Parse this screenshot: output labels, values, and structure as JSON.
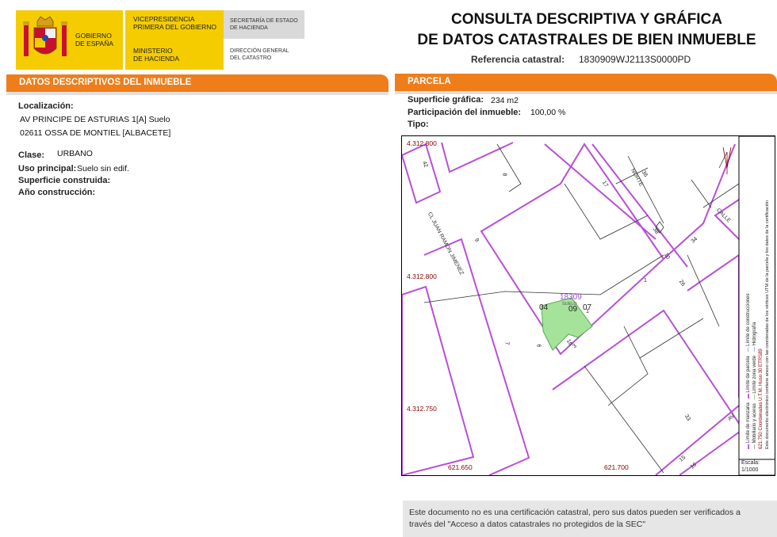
{
  "header": {
    "gov_line1": "GOBIERNO",
    "gov_line2": "DE ESPAÑA",
    "vice_line1": "VICEPRESIDENCIA",
    "vice_line2": "PRIMERA DEL GOBIERNO",
    "min_line1": "MINISTERIO",
    "min_line2": "DE HACIENDA",
    "sec_line1": "SECRETARÍA DE ESTADO",
    "sec_line2": "DE HACIENDA",
    "dir_line1": "DIRECCIÓN GENERAL",
    "dir_line2": "DEL CATASTRO",
    "title_line1": "CONSULTA DESCRIPTIVA Y GRÁFICA",
    "title_line2": "DE DATOS CATASTRALES DE BIEN INMUEBLE",
    "refcat_label": "Referencia catastral:",
    "refcat_value": "1830909WJ2113S0000PD"
  },
  "left": {
    "bar_title": "DATOS DESCRIPTIVOS DEL INMUEBLE",
    "localizacion_label": "Localización:",
    "address1": "AV PRINCIPE DE ASTURIAS 1[A] Suelo",
    "address2": "02611 OSSA DE MONTIEL [ALBACETE]",
    "clase_label": "Clase:",
    "clase_value": "URBANO",
    "uso_label": "Uso principal:",
    "uso_value": "Suelo sin edif.",
    "sup_label": "Superficie construida:",
    "anio_label": "Año construcción:"
  },
  "right": {
    "bar_title": "PARCELA",
    "supgraf_label": "Superficie gráfica:",
    "supgraf_value": "234 m2",
    "part_label": "Participación del inmueble:",
    "part_value": "100,00 %",
    "tipo_label": "Tipo:"
  },
  "map": {
    "coord_y1": "4.312.800",
    "coord_y2": "4.312.800",
    "coord_y3": "4.312.750",
    "coord_x1": "621.650",
    "coord_x2": "621.700",
    "parcel_id": "18309",
    "parcel_sub": "SUELO",
    "lbl_09": "09",
    "lbl_04": "04",
    "lbl_07": "07",
    "street1": "CL JUAN RAMON JIMENEZ",
    "street2": "NORTE",
    "street3": "CALLE",
    "street4": "AV",
    "n8": "8",
    "n7": "7",
    "n6": "6",
    "n16": "16",
    "n3": "3",
    "n1": "1",
    "n15": "15",
    "n17": "17",
    "n36": "36",
    "n34": "34",
    "n10": "10",
    "n38": "38",
    "n9": "9",
    "n1b": "1",
    "n26": "26",
    "n33": "33",
    "n42": "42",
    "n16b": "16",
    "legend_l1": "Límite de manzana",
    "legend_l2": "Límite de parcela",
    "legend_l3": "Límite de construcciones",
    "legend_l4": "Mobiliario y aceras",
    "legend_l5": "Límite zona verde",
    "legend_l6": "Hidrografía",
    "legend_coords": "621.750 Coordenadas U.T.M. Huso 30 ETRS89",
    "legend_doc": "Este documento electrónico contiene anexo con las coordenadas de los vértices UTM de la parcela y los datos de la certificación",
    "scale_label": "Escala:",
    "scale_value": "1/1000"
  },
  "notice": {
    "line1": "Este documento no es una certificación catastral, pero sus datos pueden ser verificados a",
    "line2": "través del \"Acceso a datos catastrales no protegidos de la SEC\""
  },
  "colors": {
    "orange": "#ef7d1a",
    "yellow": "#f4cc00",
    "purple": "#b84fd8",
    "parcel_green": "#a5e39b"
  }
}
